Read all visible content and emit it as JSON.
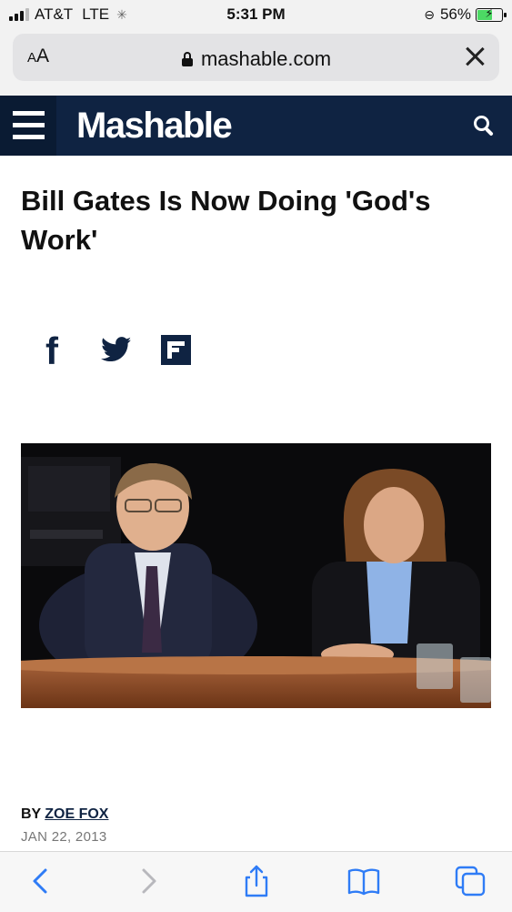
{
  "status_bar": {
    "carrier": "AT&T",
    "network": "LTE",
    "time": "5:31 PM",
    "battery_percent": "56%",
    "battery_level": 0.56,
    "charging": true
  },
  "url_bar": {
    "text_size_label_small": "A",
    "text_size_label_large": "A",
    "url": "mashable.com"
  },
  "site": {
    "logo_text": "Mashable"
  },
  "article": {
    "headline": "Bill Gates Is Now Doing 'God's Work'",
    "share_icons": [
      "facebook-icon",
      "twitter-icon",
      "flipboard-icon"
    ],
    "byline_prefix": "BY",
    "author": "ZOE FOX",
    "date": "JAN 22, 2013"
  },
  "colors": {
    "brand_navy": "#0f2342",
    "browser_chrome": "#f2f2f2",
    "toolbar_icon_blue": "#2f7cf6",
    "toolbar_icon_disabled": "#b8b8bd"
  },
  "toolbar": {
    "buttons": [
      "back-icon",
      "forward-icon",
      "share-icon",
      "bookmarks-icon",
      "tabs-icon"
    ]
  }
}
